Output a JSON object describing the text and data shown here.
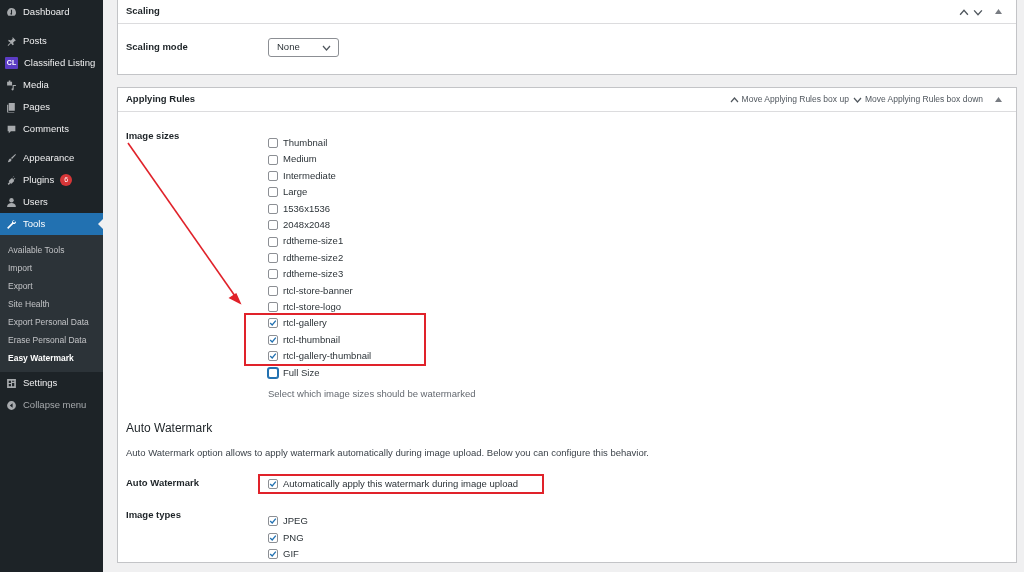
{
  "sidebar": {
    "groups": [
      [
        {
          "label": "Dashboard",
          "selected": false
        }
      ],
      [
        {
          "label": "Posts",
          "selected": false
        },
        {
          "label": "Classified Listing",
          "icon_text": "CL",
          "selected": false
        },
        {
          "label": "Media",
          "selected": false
        },
        {
          "label": "Pages",
          "selected": false
        },
        {
          "label": "Comments",
          "selected": false
        }
      ],
      [
        {
          "label": "Appearance",
          "selected": false
        },
        {
          "label": "Plugins",
          "badge": "6",
          "selected": false
        },
        {
          "label": "Users",
          "selected": false
        },
        {
          "label": "Tools",
          "selected": true,
          "children": [
            {
              "label": "Available Tools",
              "selected": false
            },
            {
              "label": "Import",
              "selected": false
            },
            {
              "label": "Export",
              "selected": false
            },
            {
              "label": "Site Health",
              "selected": false
            },
            {
              "label": "Export Personal Data",
              "selected": false
            },
            {
              "label": "Erase Personal Data",
              "selected": false
            },
            {
              "label": "Easy Watermark",
              "selected": true
            }
          ]
        },
        {
          "label": "Settings",
          "selected": false
        }
      ]
    ],
    "collapse": {
      "label": "Collapse menu"
    }
  },
  "scaling_panel": {
    "title": "Scaling",
    "fields": [
      {
        "label": "Scaling mode",
        "value": "None"
      }
    ]
  },
  "rules_panel": {
    "title": "Applying Rules",
    "move_up": "Move Applying Rules box up",
    "move_down": "Move Applying Rules box down",
    "image_sizes": {
      "label": "Image sizes",
      "arrow_annotation": true,
      "options": [
        {
          "kind": "checkbox",
          "label": "Thumbnail",
          "checked": false
        },
        {
          "kind": "checkbox",
          "label": "Medium",
          "checked": false
        },
        {
          "kind": "checkbox",
          "label": "Intermediate",
          "checked": false
        },
        {
          "kind": "checkbox",
          "label": "Large",
          "checked": false
        },
        {
          "kind": "checkbox",
          "label": "1536x1536",
          "checked": false
        },
        {
          "kind": "checkbox",
          "label": "2048x2048",
          "checked": false
        },
        {
          "kind": "checkbox",
          "label": "rdtheme-size1",
          "checked": false
        },
        {
          "kind": "checkbox",
          "label": "rdtheme-size2",
          "checked": false
        },
        {
          "kind": "checkbox",
          "label": "rdtheme-size3",
          "checked": false
        },
        {
          "kind": "checkbox",
          "label": "rtcl-store-banner",
          "checked": false
        },
        {
          "kind": "checkbox",
          "label": "rtcl-store-logo",
          "checked": false
        },
        {
          "kind": "highlight_frame",
          "options": [
            {
              "kind": "checkbox",
              "label": "rtcl-gallery",
              "checked": true
            },
            {
              "kind": "checkbox",
              "label": "rtcl-thumbnail",
              "checked": true
            },
            {
              "kind": "checkbox",
              "label": "rtcl-gallery-thumbnail",
              "checked": true
            }
          ]
        },
        {
          "kind": "focused_checkbox",
          "label": "Full Size",
          "checked": false
        }
      ],
      "hint": "Select which image sizes should be watermarked"
    },
    "auto_section": {
      "heading": "Auto Watermark",
      "description": "Auto Watermark option allows to apply watermark automatically during image upload. Below you can configure this behavior.",
      "auto_field": {
        "label": "Auto Watermark",
        "options": [
          {
            "kind": "highlight_frame",
            "options": [
              {
                "kind": "checkbox",
                "label": "Automatically apply this watermark during image upload",
                "checked": true
              }
            ]
          }
        ]
      },
      "types_field": {
        "label": "Image types",
        "options": [
          {
            "kind": "checkbox",
            "label": "JPEG",
            "checked": true
          },
          {
            "kind": "checkbox",
            "label": "PNG",
            "checked": true
          },
          {
            "kind": "checkbox",
            "label": "GIF",
            "checked": true
          }
        ]
      }
    }
  }
}
